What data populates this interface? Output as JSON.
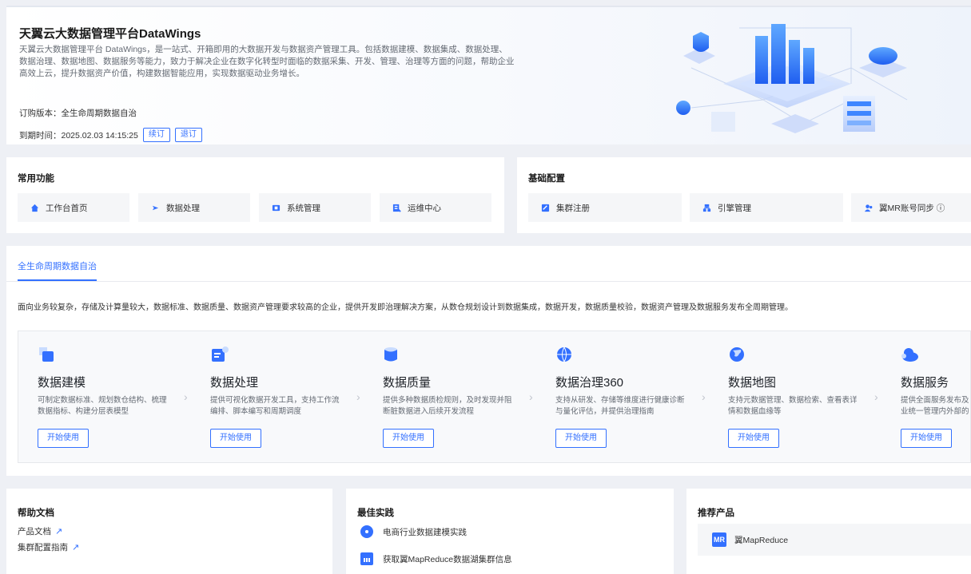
{
  "banner": {
    "title": "天翼云大数据管理平台DataWings",
    "description": "天翼云大数据管理平台 DataWings，是一站式、开箱即用的大数据开发与数据资产管理工具。包括数据建模、数据集成、数据处理、数据治理、数据地图、数据服务等能力，致力于解决企业在数字化转型时面临的数据采集、开发、管理、治理等方面的问题，帮助企业高效上云，提升数据资产价值，构建数据智能应用，实现数据驱动业务增长。",
    "version_label": "订购版本：全生命周期数据自治",
    "expire_label": "到期时间：2025.02.03 14:15:25",
    "renew": "续订",
    "unsubscribe": "退订"
  },
  "common": {
    "title": "常用功能",
    "items": [
      {
        "label": "工作台首页",
        "icon": "home-icon"
      },
      {
        "label": "数据处理",
        "icon": "data-process-icon"
      },
      {
        "label": "系统管理",
        "icon": "system-icon"
      },
      {
        "label": "运维中心",
        "icon": "ops-icon"
      }
    ]
  },
  "config": {
    "title": "基础配置",
    "items": [
      {
        "label": "集群注册",
        "icon": "cluster-icon"
      },
      {
        "label": "引擎管理",
        "icon": "engine-icon"
      },
      {
        "label": "翼MR账号同步 ⓘ",
        "icon": "user-sync-icon"
      }
    ]
  },
  "tab": {
    "label": "全生命周期数据自治"
  },
  "intro": "面向业务较复杂，存储及计算量较大，数据标准、数据质量、数据资产管理要求较高的企业，提供开发即治理解决方案，从数仓规划设计到数据集成，数据开发，数据质量校验，数据资产管理及数据服务发布全周期管理。",
  "steps": [
    {
      "title": "数据建模",
      "desc1": "可制定数据标准、规划数仓结构、梳理",
      "desc2": "数据指标、构建分层表模型",
      "button": "开始使用"
    },
    {
      "title": "数据处理",
      "desc1": "提供可视化数据开发工具，支持工作流",
      "desc2": "编排、脚本编写和周期调度",
      "button": "开始使用"
    },
    {
      "title": "数据质量",
      "desc1": "提供多种数据质检规则，及时发现并阻",
      "desc2": "断脏数据进入后续开发流程",
      "button": "开始使用"
    },
    {
      "title": "数据治理360",
      "desc1": "支持从研发、存储等维度进行健康诊断",
      "desc2": "与量化评估，并提供治理指南",
      "button": "开始使用"
    },
    {
      "title": "数据地图",
      "desc1": "支持元数据管理、数据检索、查看表详",
      "desc2": "情和数据血缘等",
      "button": "开始使用"
    },
    {
      "title": "数据服务",
      "desc1": "提供全面服务发布及其",
      "desc2": "业统一管理内外部的A",
      "button": "开始使用"
    }
  ],
  "help": {
    "title": "帮助文档",
    "links": [
      "产品文档",
      "集群配置指南"
    ]
  },
  "best": {
    "title": "最佳实践",
    "items": [
      "电商行业数据建模实践",
      "获取翼MapReduce数据湖集群信息"
    ]
  },
  "recommend": {
    "title": "推荐产品",
    "badge": "MR",
    "product": "翼MapReduce"
  },
  "colors": {
    "accent": "#3370ff"
  }
}
